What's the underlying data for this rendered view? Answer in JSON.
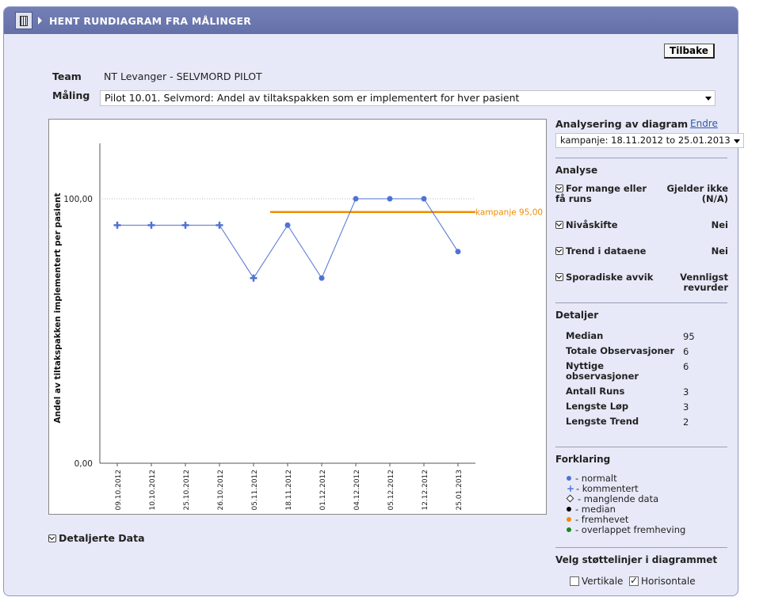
{
  "header": {
    "title": "HENT RUNDIAGRAM FRA MÅLINGER",
    "icon": "building-icon"
  },
  "buttons": {
    "back": "Tilbake"
  },
  "form": {
    "team_label": "Team",
    "team_value": "NT Levanger - SELVMORD PILOT",
    "measure_label": "Måling",
    "measure_value": "Pilot 10.01. Selvmord: Andel av tiltakspakken som er implementert for hver pasient"
  },
  "chart_data": {
    "type": "line",
    "ylabel": "Andel av tiltakspakken implementert per pasient",
    "ylim": [
      0,
      100
    ],
    "yticks": [
      "0,00",
      "100,00"
    ],
    "x": [
      "09.10.2012",
      "10.10.2012",
      "25.10.2012",
      "26.10.2012",
      "05.11.2012",
      "18.11.2012",
      "01.12.2012",
      "04.12.2012",
      "05.12.2012",
      "12.12.2012",
      "25.01.2013"
    ],
    "values": [
      90,
      90,
      90,
      90,
      70,
      90,
      70,
      100,
      100,
      100,
      80
    ],
    "markers": [
      "comment",
      "comment",
      "comment",
      "comment",
      "comment",
      "normal",
      "normal",
      "normal",
      "normal",
      "normal",
      "normal"
    ],
    "median": {
      "label": "kampanje 95,00",
      "value": 95,
      "from_index": 5,
      "to_index": 10,
      "color": "#f08c00"
    },
    "series_color": "#4f72d4",
    "gridline_value": 100
  },
  "analysis": {
    "title": "Analysering av diagram",
    "change_link": "Endre",
    "period_value": "kampanje: 18.11.2012 to 25.01.2013",
    "section_title": "Analyse",
    "items": [
      {
        "label": "For mange eller få runs",
        "value": "Gjelder ikke (N/A)"
      },
      {
        "label": "Nivåskifte",
        "value": "Nei"
      },
      {
        "label": "Trend i dataene",
        "value": "Nei"
      },
      {
        "label": "Sporadiske avvik",
        "value": "Vennligst revurder"
      }
    ]
  },
  "details": {
    "title": "Detaljer",
    "rows": [
      {
        "label": "Median",
        "value": "95"
      },
      {
        "label": "Totale Observasjoner",
        "value": "6"
      },
      {
        "label": "Nyttige observasjoner",
        "value": "6"
      },
      {
        "label": "Antall Runs",
        "value": "3"
      },
      {
        "label": "Lengste Løp",
        "value": "3"
      },
      {
        "label": "Lengste Trend",
        "value": "2"
      }
    ]
  },
  "legend": {
    "title": "Forklaring",
    "items": [
      {
        "label": "- normalt",
        "color": "#4f72d4",
        "shape": "dot"
      },
      {
        "label": "- kommentert",
        "color": "#4f72d4",
        "shape": "cross"
      },
      {
        "label": "- manglende data",
        "color": "#ffffff",
        "shape": "hollow-diamond"
      },
      {
        "label": "- median",
        "color": "#000000",
        "shape": "dot"
      },
      {
        "label": "- fremhevet",
        "color": "#f08c00",
        "shape": "dot"
      },
      {
        "label": "- overlappet fremheving",
        "color": "#1a8a1a",
        "shape": "dot"
      }
    ]
  },
  "support_lines": {
    "title": "Velg støttelinjer i diagrammet",
    "vertical_label": "Vertikale",
    "vertical_checked": false,
    "horizontal_label": "Horisontale",
    "horizontal_checked": true
  },
  "detailed_data": {
    "label": "Detaljerte Data"
  }
}
